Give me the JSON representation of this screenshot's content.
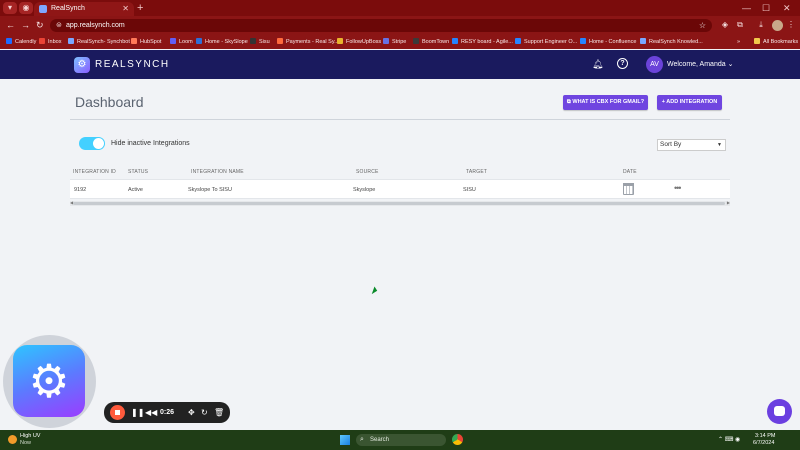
{
  "browser": {
    "tab_title": "RealSynch",
    "url": "app.realsynch.com",
    "all_bookmarks": "All Bookmarks",
    "bookmarks": [
      {
        "label": "Calendly",
        "color": "#1f6bff"
      },
      {
        "label": "Inbox",
        "color": "#ea4335"
      },
      {
        "label": "RealSynch- Synchbot",
        "color": "#7aa7ff"
      },
      {
        "label": "HubSpot",
        "color": "#ff7a59"
      },
      {
        "label": "Loom",
        "color": "#625df5"
      },
      {
        "label": "Home - SkySlope",
        "color": "#2f6fd6"
      },
      {
        "label": "Sisu",
        "color": "#333333"
      },
      {
        "label": "Payments - Real Sy...",
        "color": "#ff6a3d"
      },
      {
        "label": "FollowUpBoss",
        "color": "#e8b32d"
      },
      {
        "label": "Stripe",
        "color": "#6772e5"
      },
      {
        "label": "BoomTown",
        "color": "#3a3a3a"
      },
      {
        "label": "RESY board - Agile...",
        "color": "#2684ff"
      },
      {
        "label": "Support Engineer O...",
        "color": "#2684ff"
      },
      {
        "label": "Home - Confluence",
        "color": "#2684ff"
      },
      {
        "label": "RealSynch Knowled...",
        "color": "#7aa7ff"
      }
    ]
  },
  "app": {
    "logo_text": "REALSYNCH",
    "avatar_initials": "AV",
    "welcome_text": "Welcome, Amanda"
  },
  "dashboard": {
    "title": "Dashboard",
    "btn_cbx": "WHAT IS CBX FOR GMAIL?",
    "btn_add": "+ ADD INTEGRATION",
    "toggle_label": "Hide inactive Integrations",
    "toggle_on": true,
    "sort_label": "Sort By"
  },
  "table": {
    "columns": [
      "INTEGRATION ID",
      "STATUS",
      "INTEGRATION NAME",
      "SOURCE",
      "TARGET",
      "DATE"
    ],
    "rows": [
      {
        "id": "9192",
        "status": "Active",
        "name": "Skyslope To SISU",
        "source": "Skyslope",
        "target": "SISU"
      }
    ]
  },
  "recorder": {
    "time": "0:26"
  },
  "taskbar": {
    "weather_title": "High UV",
    "weather_sub": "Now",
    "search_placeholder": "Search",
    "time": "3:14 PM",
    "date": "6/7/2024"
  }
}
